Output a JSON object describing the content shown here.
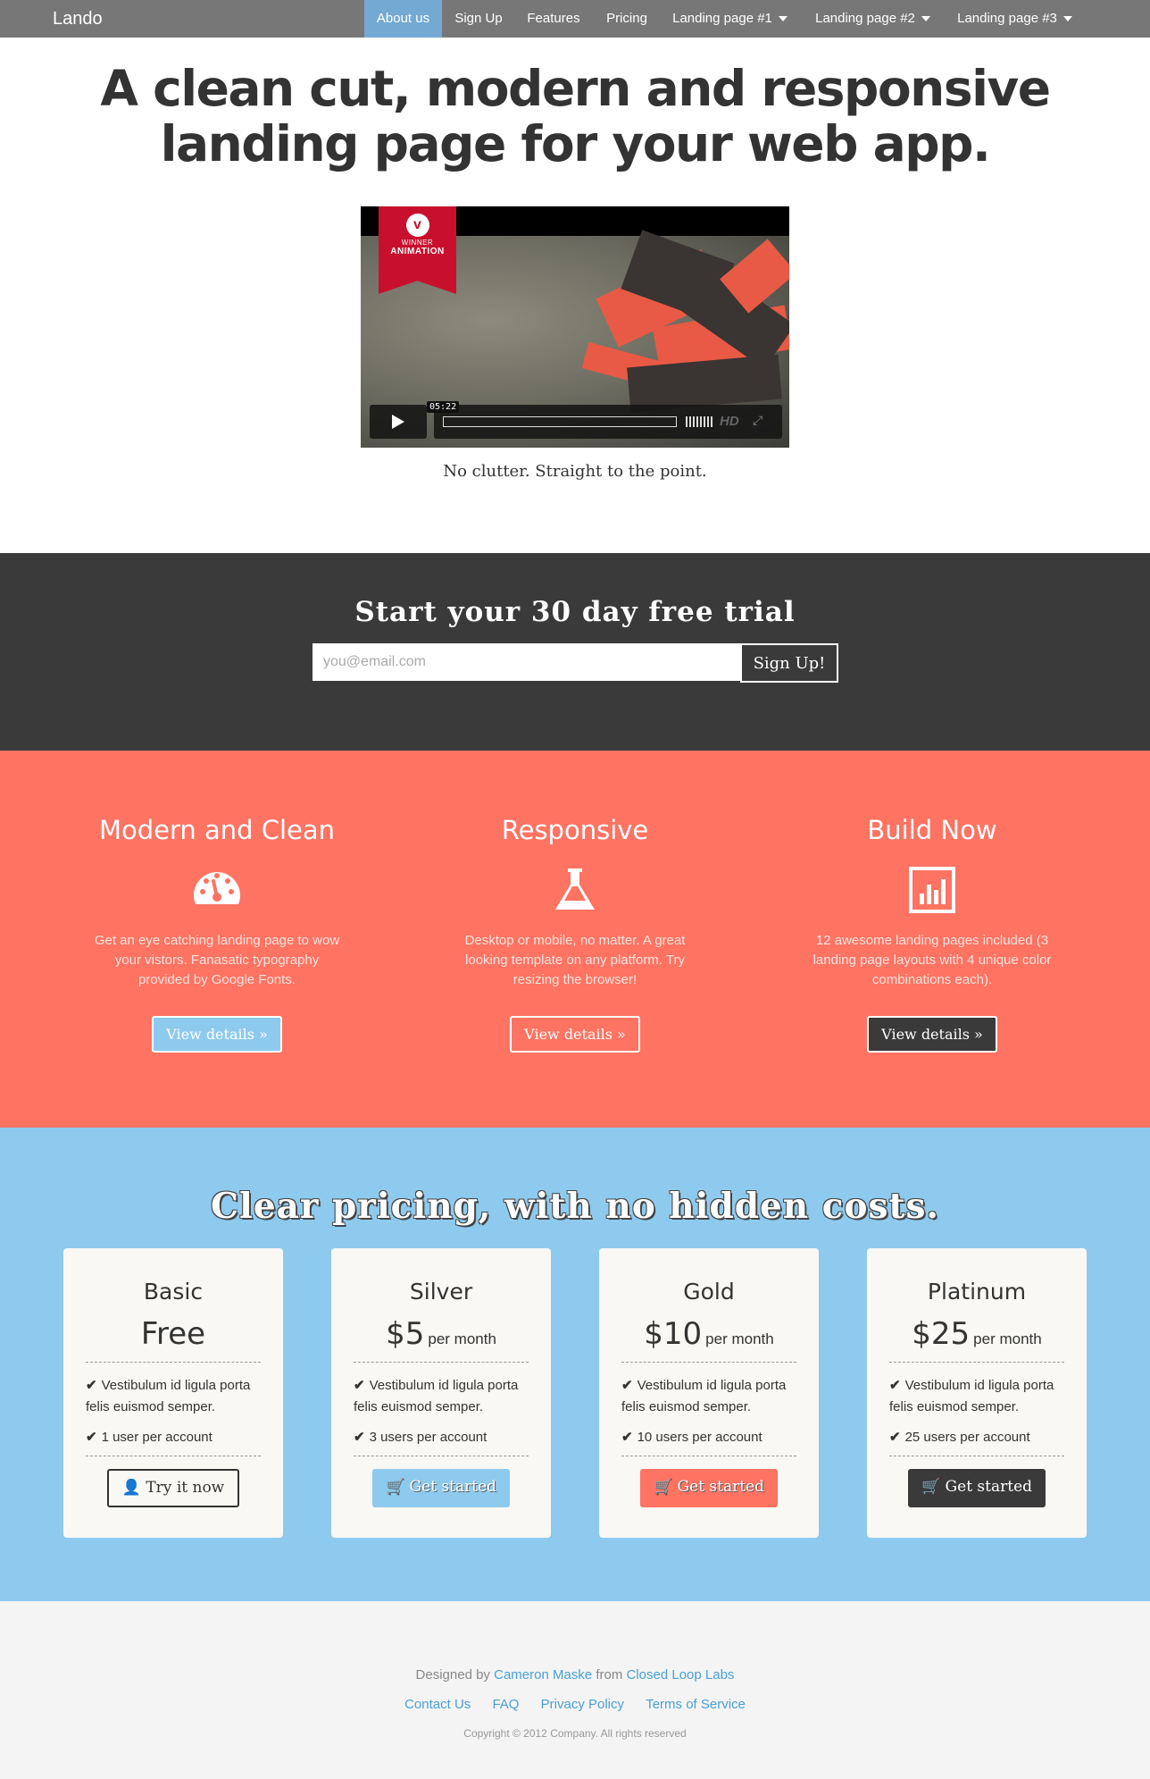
{
  "nav": {
    "brand": "Lando",
    "items": [
      {
        "label": "About us",
        "active": true
      },
      {
        "label": "Sign Up"
      },
      {
        "label": "Features"
      },
      {
        "label": "Pricing"
      },
      {
        "label": "Landing page #1",
        "dropdown": true
      },
      {
        "label": "Landing page #2",
        "dropdown": true
      },
      {
        "label": "Landing page #3",
        "dropdown": true
      }
    ]
  },
  "hero": {
    "title_line1": "A clean cut, modern and responsive",
    "title_line2": "landing page for your web app.",
    "tagline": "No clutter. Straight to the point."
  },
  "video": {
    "badge_logo": "v",
    "badge_line1": "WINNER",
    "badge_line2": "ANIMATION",
    "time": "05:22",
    "hd_label": "HD"
  },
  "trial": {
    "title": "Start your 30 day free trial",
    "email_placeholder": "you@email.com",
    "button": "Sign Up!"
  },
  "features": [
    {
      "title": "Modern and Clean",
      "icon": "dashboard-icon",
      "text": "Get an eye catching landing page to wow your vistors. Fanasatic typography provided by Google Fonts.",
      "button": "View details »",
      "button_color": "#8ecaee"
    },
    {
      "title": "Responsive",
      "icon": "flask-icon",
      "text": "Desktop or mobile, no matter. A great looking template on any platform. Try resizing the browser!",
      "button": "View details »",
      "button_color": "#fe7362"
    },
    {
      "title": "Build Now",
      "icon": "bar-chart-icon",
      "text": "12 awesome landing pages included (3 landing page layouts with 4 unique color combinations each).",
      "button": "View details »",
      "button_color": "#3a3a3a"
    }
  ],
  "pricing": {
    "title": "Clear pricing, with no hidden costs.",
    "plans": [
      {
        "name": "Basic",
        "price": "Free",
        "per": "",
        "feature": "Vestibulum id ligula porta felis euismod semper.",
        "users": "1 user per account",
        "button": "Try it now",
        "button_icon": "user-icon"
      },
      {
        "name": "Silver",
        "price": "$5",
        "per": "per month",
        "feature": "Vestibulum id ligula porta felis euismod semper.",
        "users": "3 users per account",
        "button": "Get started",
        "button_icon": "cart-icon"
      },
      {
        "name": "Gold",
        "price": "$10",
        "per": "per month",
        "feature": "Vestibulum id ligula porta felis euismod semper.",
        "users": "10 users per account",
        "button": "Get started",
        "button_icon": "cart-icon"
      },
      {
        "name": "Platinum",
        "price": "$25",
        "per": "per month",
        "feature": "Vestibulum id ligula porta felis euismod semper.",
        "users": "25 users per account",
        "button": "Get started",
        "button_icon": "cart-icon"
      }
    ]
  },
  "footer": {
    "designed_by": "Designed by",
    "author": "Cameron Maske",
    "from": "from",
    "company": "Closed Loop Labs",
    "links": [
      "Contact Us",
      "FAQ",
      "Privacy Policy",
      "Terms of Service"
    ],
    "copyright": "Copyright © 2012 Company. All rights reserved"
  },
  "colors": {
    "nav": "#777777",
    "nav_active": "#74a9d4",
    "dark": "#3a3a3a",
    "coral": "#fe7362",
    "sky": "#8ecaee",
    "link": "#4aa0d5"
  }
}
